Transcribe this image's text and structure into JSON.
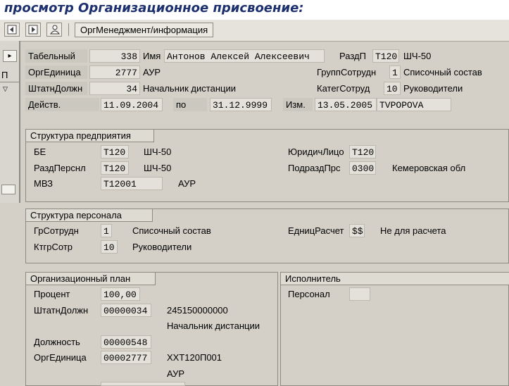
{
  "window": {
    "title": "просмотр Организационное присвоение:"
  },
  "toolbar": {
    "orgmanagement_label": "ОргМенеджмент/информация"
  },
  "left_pane": {
    "label": "П"
  },
  "header": {
    "personnel_no": {
      "label": "Табельный",
      "value": "338"
    },
    "name": {
      "label": "Имя",
      "value": "Антонов Алексей Алексеевич"
    },
    "area": {
      "label": "РаздП",
      "code": "Т120",
      "text": "ШЧ-50"
    },
    "org_unit": {
      "label": "ОргЕдиница",
      "value": "2777",
      "text": "АУР"
    },
    "employee_group": {
      "label": "ГруппСотрудн",
      "code": "1",
      "text": "Списочный состав"
    },
    "position": {
      "label": "ШтатнДолжн",
      "value": "34",
      "text": "Начальник дистанции"
    },
    "employee_subgroup": {
      "label": "КатегСотруд",
      "code": "10",
      "text": "Руководители"
    },
    "valid": {
      "label": "Действ.",
      "from": "11.09.2004",
      "to_label": "по",
      "to": "31.12.9999"
    },
    "changed": {
      "label": "Изм.",
      "date": "13.05.2005",
      "user": "TVPOPOVA"
    }
  },
  "enterprise_structure": {
    "title": "Структура предприятия",
    "company_code": {
      "label": "БЕ",
      "code": "Т120",
      "text": "ШЧ-50"
    },
    "personnel_area": {
      "label": "РаздПерснл",
      "code": "Т120",
      "text": "ШЧ-50"
    },
    "cost_center": {
      "label": "МВЗ",
      "code": "Т12001",
      "text": "АУР"
    },
    "legal_person": {
      "label": "ЮридичЛицо",
      "code": "Т120"
    },
    "subarea": {
      "label": "ПодраздПрс",
      "code": "0300",
      "text": "Кемеровская обл"
    }
  },
  "personnel_structure": {
    "title": "Структура персонала",
    "group": {
      "label": "ГрСотрудн",
      "code": "1",
      "text": "Списочный состав"
    },
    "subgroup": {
      "label": "КтгрСотр",
      "code": "10",
      "text": "Руководители"
    },
    "payroll_unit": {
      "label": "ЕдницРасчет",
      "code": "$$",
      "text": "Не для расчета"
    }
  },
  "org_plan": {
    "title": "Организационный план",
    "percent": {
      "label": "Процент",
      "value": "100,00"
    },
    "position": {
      "label": "ШтатнДолжн",
      "code": "00000034",
      "text1": "245150000000",
      "text2": "Начальник дистанции"
    },
    "job": {
      "label": "Должность",
      "code": "00000548"
    },
    "org_unit": {
      "label": "ОргЕдиница",
      "code": "00002777",
      "text1": "ХХТ120П001",
      "text2": "АУР"
    }
  },
  "executor": {
    "title": "Исполнитель",
    "personnel": {
      "label": "Персонал",
      "value": ""
    }
  }
}
